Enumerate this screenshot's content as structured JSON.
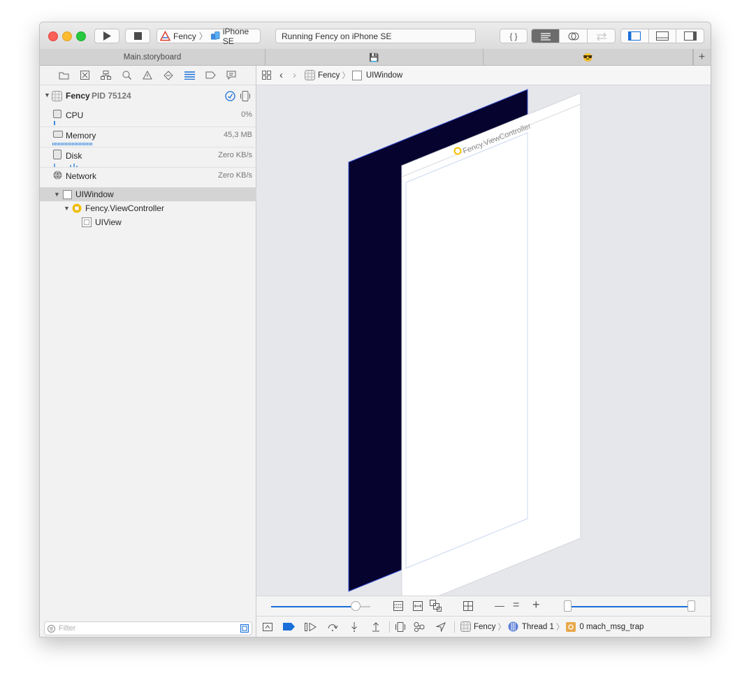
{
  "toolbar": {
    "scheme_target": "Fency",
    "scheme_device": "iPhone SE",
    "status_text": "Running Fency on iPhone SE",
    "code_review_label": "{ }"
  },
  "tabs": [
    {
      "label": "Main.storyboard"
    },
    {
      "label": "💾"
    },
    {
      "label": "😎"
    },
    {
      "label": "+"
    }
  ],
  "navigator": {
    "process": {
      "name": "Fency",
      "pid_label": "PID 75124"
    },
    "gauges": [
      {
        "label": "CPU",
        "value": "0%"
      },
      {
        "label": "Memory",
        "value": "45,3 MB"
      },
      {
        "label": "Disk",
        "value": "Zero KB/s"
      },
      {
        "label": "Network",
        "value": "Zero KB/s"
      }
    ],
    "tree": [
      {
        "label": "UIWindow"
      },
      {
        "label": "Fency.ViewController"
      },
      {
        "label": "UIView"
      }
    ],
    "filter_placeholder": "Filter"
  },
  "jumpbar": {
    "items": [
      {
        "label": "Fency"
      },
      {
        "label": "UIWindow"
      }
    ]
  },
  "canvas": {
    "scene_title": "Fency.ViewController",
    "window_color": "#06032e"
  },
  "canvas_controls": {
    "minus_label": "—",
    "equal_label": "=",
    "plus_label": "+",
    "spacing_fraction": 0.85
  },
  "debugbar": {
    "crumbs": [
      {
        "label": "Fency"
      },
      {
        "label": "Thread 1"
      },
      {
        "label": "0 mach_msg_trap"
      }
    ]
  }
}
